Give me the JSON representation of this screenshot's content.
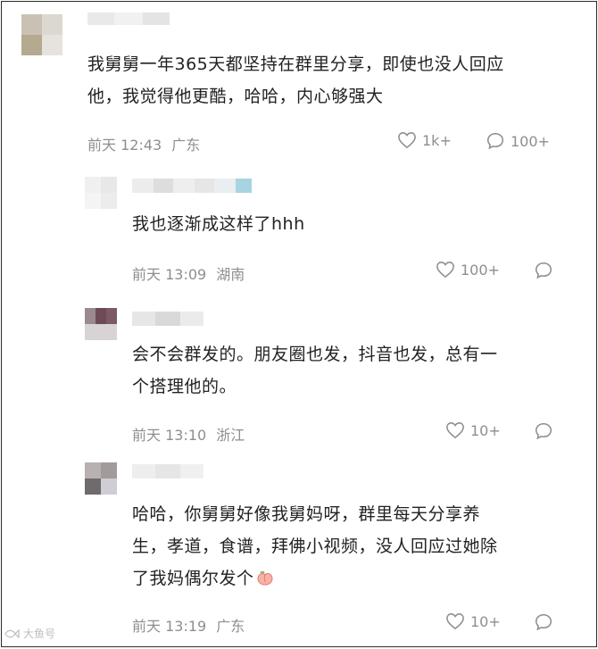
{
  "comments": [
    {
      "text_lines": [
        "我舅舅一年365天都坚持在群里分享，即使也没人回应",
        "他，我觉得他更酷，哈哈，内心够强大"
      ],
      "time": "前天 12:43",
      "location": "广东",
      "likes": "1k+",
      "replies": "100+"
    },
    {
      "text_lines": [
        "我也逐渐成这样了hhh"
      ],
      "time": "前天 13:09",
      "location": "湖南",
      "likes": "100+"
    },
    {
      "text_lines": [
        "会不会群发的。朋友圈也发，抖音也发，总有一",
        "个搭理他的。"
      ],
      "time": "前天 13:10",
      "location": "浙江",
      "likes": "10+"
    },
    {
      "text_lines": [
        "哈哈，你舅舅好像我舅妈呀，群里每天分享养",
        "生，孝道，食谱，拜佛小视频，没人回应过她除",
        "了我妈偶尔发个"
      ],
      "time": "前天 13:19",
      "location": "广东",
      "likes": "10+"
    }
  ],
  "watermark": "大鱼号",
  "colors": {
    "text": "#222222",
    "meta": "#8e8e8e",
    "border": "#2b2b2b"
  },
  "icons": [
    "heart-icon",
    "comment-bubble-icon",
    "peach-emoji-icon"
  ]
}
